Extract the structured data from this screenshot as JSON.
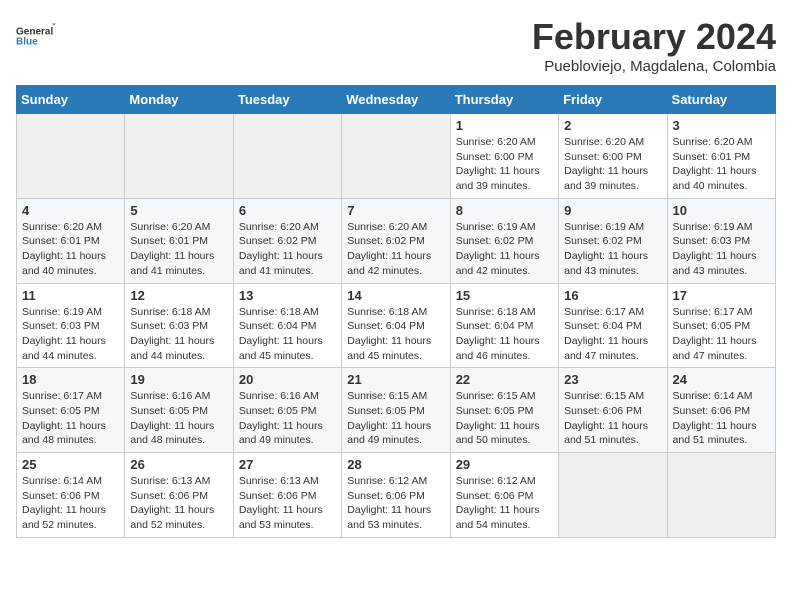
{
  "header": {
    "logo_general": "General",
    "logo_blue": "Blue",
    "month_year": "February 2024",
    "location": "Puebloviejo, Magdalena, Colombia"
  },
  "weekdays": [
    "Sunday",
    "Monday",
    "Tuesday",
    "Wednesday",
    "Thursday",
    "Friday",
    "Saturday"
  ],
  "weeks": [
    [
      {
        "day": "",
        "sunrise": "",
        "sunset": "",
        "daylight": "",
        "empty": true
      },
      {
        "day": "",
        "sunrise": "",
        "sunset": "",
        "daylight": "",
        "empty": true
      },
      {
        "day": "",
        "sunrise": "",
        "sunset": "",
        "daylight": "",
        "empty": true
      },
      {
        "day": "",
        "sunrise": "",
        "sunset": "",
        "daylight": "",
        "empty": true
      },
      {
        "day": "1",
        "sunrise": "Sunrise: 6:20 AM",
        "sunset": "Sunset: 6:00 PM",
        "daylight": "Daylight: 11 hours and 39 minutes.",
        "empty": false
      },
      {
        "day": "2",
        "sunrise": "Sunrise: 6:20 AM",
        "sunset": "Sunset: 6:00 PM",
        "daylight": "Daylight: 11 hours and 39 minutes.",
        "empty": false
      },
      {
        "day": "3",
        "sunrise": "Sunrise: 6:20 AM",
        "sunset": "Sunset: 6:01 PM",
        "daylight": "Daylight: 11 hours and 40 minutes.",
        "empty": false
      }
    ],
    [
      {
        "day": "4",
        "sunrise": "Sunrise: 6:20 AM",
        "sunset": "Sunset: 6:01 PM",
        "daylight": "Daylight: 11 hours and 40 minutes.",
        "empty": false
      },
      {
        "day": "5",
        "sunrise": "Sunrise: 6:20 AM",
        "sunset": "Sunset: 6:01 PM",
        "daylight": "Daylight: 11 hours and 41 minutes.",
        "empty": false
      },
      {
        "day": "6",
        "sunrise": "Sunrise: 6:20 AM",
        "sunset": "Sunset: 6:02 PM",
        "daylight": "Daylight: 11 hours and 41 minutes.",
        "empty": false
      },
      {
        "day": "7",
        "sunrise": "Sunrise: 6:20 AM",
        "sunset": "Sunset: 6:02 PM",
        "daylight": "Daylight: 11 hours and 42 minutes.",
        "empty": false
      },
      {
        "day": "8",
        "sunrise": "Sunrise: 6:19 AM",
        "sunset": "Sunset: 6:02 PM",
        "daylight": "Daylight: 11 hours and 42 minutes.",
        "empty": false
      },
      {
        "day": "9",
        "sunrise": "Sunrise: 6:19 AM",
        "sunset": "Sunset: 6:02 PM",
        "daylight": "Daylight: 11 hours and 43 minutes.",
        "empty": false
      },
      {
        "day": "10",
        "sunrise": "Sunrise: 6:19 AM",
        "sunset": "Sunset: 6:03 PM",
        "daylight": "Daylight: 11 hours and 43 minutes.",
        "empty": false
      }
    ],
    [
      {
        "day": "11",
        "sunrise": "Sunrise: 6:19 AM",
        "sunset": "Sunset: 6:03 PM",
        "daylight": "Daylight: 11 hours and 44 minutes.",
        "empty": false
      },
      {
        "day": "12",
        "sunrise": "Sunrise: 6:18 AM",
        "sunset": "Sunset: 6:03 PM",
        "daylight": "Daylight: 11 hours and 44 minutes.",
        "empty": false
      },
      {
        "day": "13",
        "sunrise": "Sunrise: 6:18 AM",
        "sunset": "Sunset: 6:04 PM",
        "daylight": "Daylight: 11 hours and 45 minutes.",
        "empty": false
      },
      {
        "day": "14",
        "sunrise": "Sunrise: 6:18 AM",
        "sunset": "Sunset: 6:04 PM",
        "daylight": "Daylight: 11 hours and 45 minutes.",
        "empty": false
      },
      {
        "day": "15",
        "sunrise": "Sunrise: 6:18 AM",
        "sunset": "Sunset: 6:04 PM",
        "daylight": "Daylight: 11 hours and 46 minutes.",
        "empty": false
      },
      {
        "day": "16",
        "sunrise": "Sunrise: 6:17 AM",
        "sunset": "Sunset: 6:04 PM",
        "daylight": "Daylight: 11 hours and 47 minutes.",
        "empty": false
      },
      {
        "day": "17",
        "sunrise": "Sunrise: 6:17 AM",
        "sunset": "Sunset: 6:05 PM",
        "daylight": "Daylight: 11 hours and 47 minutes.",
        "empty": false
      }
    ],
    [
      {
        "day": "18",
        "sunrise": "Sunrise: 6:17 AM",
        "sunset": "Sunset: 6:05 PM",
        "daylight": "Daylight: 11 hours and 48 minutes.",
        "empty": false
      },
      {
        "day": "19",
        "sunrise": "Sunrise: 6:16 AM",
        "sunset": "Sunset: 6:05 PM",
        "daylight": "Daylight: 11 hours and 48 minutes.",
        "empty": false
      },
      {
        "day": "20",
        "sunrise": "Sunrise: 6:16 AM",
        "sunset": "Sunset: 6:05 PM",
        "daylight": "Daylight: 11 hours and 49 minutes.",
        "empty": false
      },
      {
        "day": "21",
        "sunrise": "Sunrise: 6:15 AM",
        "sunset": "Sunset: 6:05 PM",
        "daylight": "Daylight: 11 hours and 49 minutes.",
        "empty": false
      },
      {
        "day": "22",
        "sunrise": "Sunrise: 6:15 AM",
        "sunset": "Sunset: 6:05 PM",
        "daylight": "Daylight: 11 hours and 50 minutes.",
        "empty": false
      },
      {
        "day": "23",
        "sunrise": "Sunrise: 6:15 AM",
        "sunset": "Sunset: 6:06 PM",
        "daylight": "Daylight: 11 hours and 51 minutes.",
        "empty": false
      },
      {
        "day": "24",
        "sunrise": "Sunrise: 6:14 AM",
        "sunset": "Sunset: 6:06 PM",
        "daylight": "Daylight: 11 hours and 51 minutes.",
        "empty": false
      }
    ],
    [
      {
        "day": "25",
        "sunrise": "Sunrise: 6:14 AM",
        "sunset": "Sunset: 6:06 PM",
        "daylight": "Daylight: 11 hours and 52 minutes.",
        "empty": false
      },
      {
        "day": "26",
        "sunrise": "Sunrise: 6:13 AM",
        "sunset": "Sunset: 6:06 PM",
        "daylight": "Daylight: 11 hours and 52 minutes.",
        "empty": false
      },
      {
        "day": "27",
        "sunrise": "Sunrise: 6:13 AM",
        "sunset": "Sunset: 6:06 PM",
        "daylight": "Daylight: 11 hours and 53 minutes.",
        "empty": false
      },
      {
        "day": "28",
        "sunrise": "Sunrise: 6:12 AM",
        "sunset": "Sunset: 6:06 PM",
        "daylight": "Daylight: 11 hours and 53 minutes.",
        "empty": false
      },
      {
        "day": "29",
        "sunrise": "Sunrise: 6:12 AM",
        "sunset": "Sunset: 6:06 PM",
        "daylight": "Daylight: 11 hours and 54 minutes.",
        "empty": false
      },
      {
        "day": "",
        "sunrise": "",
        "sunset": "",
        "daylight": "",
        "empty": true
      },
      {
        "day": "",
        "sunrise": "",
        "sunset": "",
        "daylight": "",
        "empty": true
      }
    ]
  ]
}
